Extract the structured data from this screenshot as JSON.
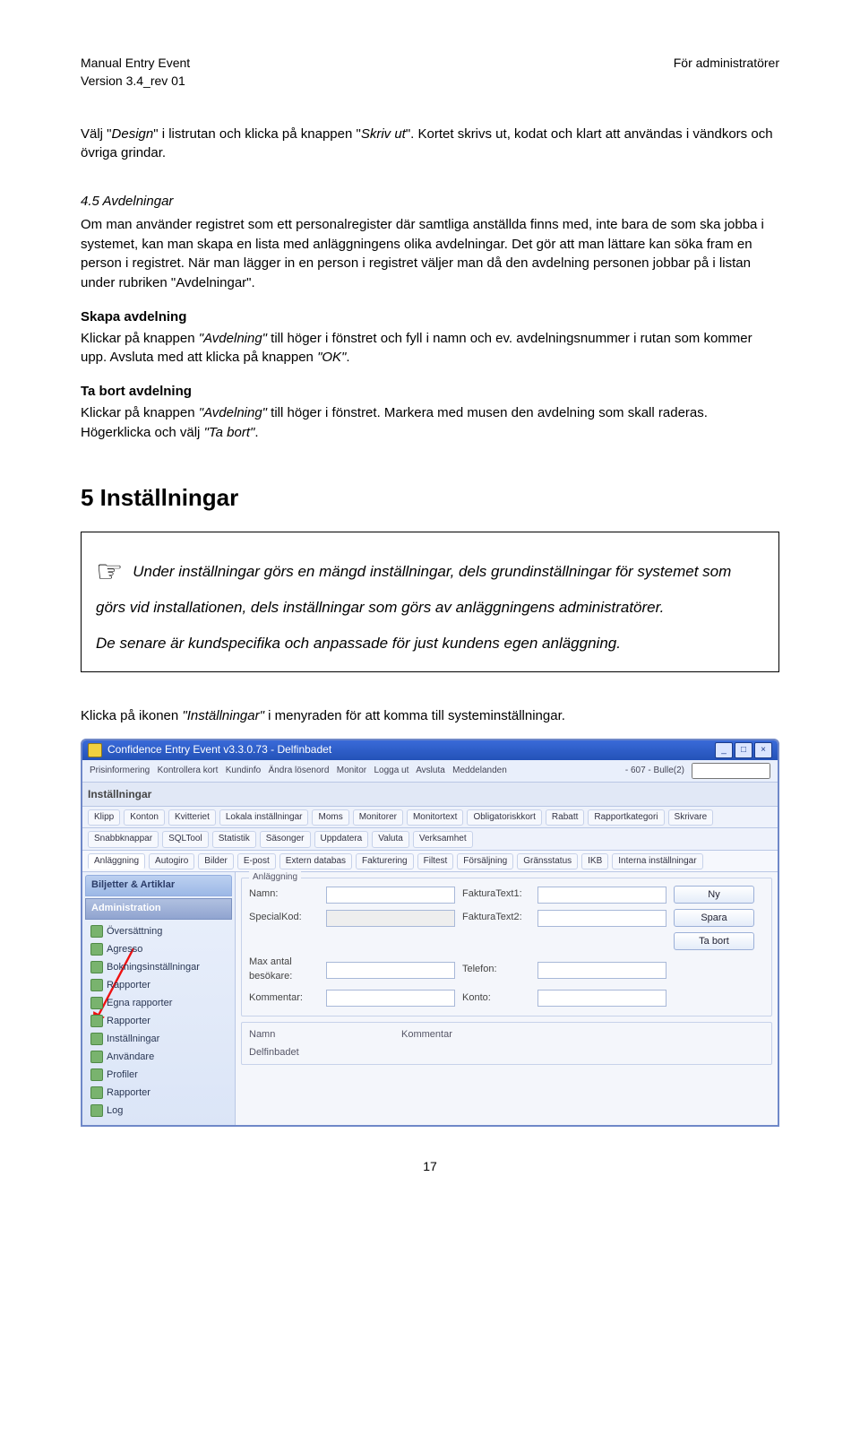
{
  "header": {
    "doc_title": "Manual Entry Event",
    "version": "Version 3.4_rev 01",
    "audience": "För administratörer"
  },
  "intro": {
    "pre": "Välj \"",
    "design": "Design",
    "mid1": "\" i listrutan och klicka på knappen \"",
    "skrivut": "Skriv ut",
    "post": "\". Kortet skrivs ut, kodat och klart att användas i vändkors och övriga grindar."
  },
  "s45": {
    "heading": "4.5  Avdelningar",
    "para1": "Om man använder registret som ett personalregister där samtliga anställda finns med, inte bara de som ska jobba i systemet, kan man skapa en lista med anläggningens olika avdelningar. Det gör att man lättare kan söka fram en person i registret. När man lägger in en person i registret väljer man då den avdelning personen jobbar på i listan under rubriken \"Avdelningar\".",
    "skapa_h": "Skapa avdelning",
    "skapa_pre": "Klickar på knappen ",
    "skapa_em1": "\"Avdelning\"",
    "skapa_mid": " till höger i fönstret och fyll i namn och ev. avdelningsnummer i rutan som kommer upp. Avsluta med att klicka på knappen ",
    "skapa_em2": "\"OK\"",
    "skapa_end": ".",
    "tabort_h": "Ta bort avdelning",
    "tabort_pre": "Klickar på knappen ",
    "tabort_em1": "\"Avdelning\"",
    "tabort_mid": " till höger i fönstret. Markera med musen den avdelning som skall raderas. Högerklicka och välj ",
    "tabort_em2": "\"Ta bort\"",
    "tabort_end": "."
  },
  "s5": {
    "heading": "5  Inställningar",
    "box_p1a": "Under inställningar görs en mängd inställningar, dels grundinställningar för systemet som görs vid installationen, dels inställningar som görs av anläggningens administratörer.",
    "box_p2": "De senare är kundspecifika och anpassade för just kundens egen anläggning.",
    "after_pre": "Klicka på ikonen ",
    "after_em": "\"Inställningar\"",
    "after_post": " i menyraden för att komma till systeminställningar."
  },
  "app": {
    "title": "Confidence Entry Event v3.3.0.73 - Delfinbadet",
    "top_right_code": "- 607 - Bulle(2)",
    "toolbar_label": "Inställningar",
    "tabs1": [
      "Klipp",
      "Konton",
      "Kvitteriet",
      "Lokala inställningar",
      "Moms",
      "Monitorer",
      "Monitortext",
      "Obligatoriskkort",
      "Rabatt",
      "Rapportkategori",
      "Skrivare"
    ],
    "tabs2": [
      "Snabbknappar",
      "SQLTool",
      "Statistik",
      "Säsonger",
      "Uppdatera",
      "Valuta",
      "Verksamhet"
    ],
    "tabs3": [
      "Anläggning",
      "Autogiro",
      "Bilder",
      "E-post",
      "Extern databas",
      "Fakturering",
      "Filtest",
      "Försäljning",
      "Gränsstatus",
      "IKB",
      "Interna inställningar"
    ],
    "side": {
      "h1": "Biljetter & Artiklar",
      "h2": "Administration",
      "items": [
        "Översättning",
        "Agresso",
        "Bokningsinställningar",
        "Rapporter",
        "Egna rapporter",
        "Rapporter",
        "Inställningar",
        "Användare",
        "Profiler",
        "Rapporter",
        "Log"
      ]
    },
    "form": {
      "group_legend": "Anläggning",
      "labels": {
        "namn": "Namn:",
        "fakt1": "FakturaText1:",
        "specialkod": "SpecialKod:",
        "fakt2": "FakturaText2:",
        "maxantal": "Max antal besökare:",
        "telefon": "Telefon:",
        "kommentar": "Kommentar:",
        "konto": "Konto:"
      },
      "buttons": {
        "ny": "Ny",
        "spara": "Spara",
        "tabort": "Ta bort"
      }
    },
    "bottom": {
      "namn": "Namn",
      "kommentar": "Kommentar",
      "item": "Delfinbadet"
    },
    "top_links": [
      "Prisinformering",
      "Kontrollera kort",
      "Kundinfo",
      "Ändra lösenord",
      "Monitor",
      "Logga ut",
      "Avsluta",
      "Meddelanden"
    ]
  },
  "page_number": "17"
}
